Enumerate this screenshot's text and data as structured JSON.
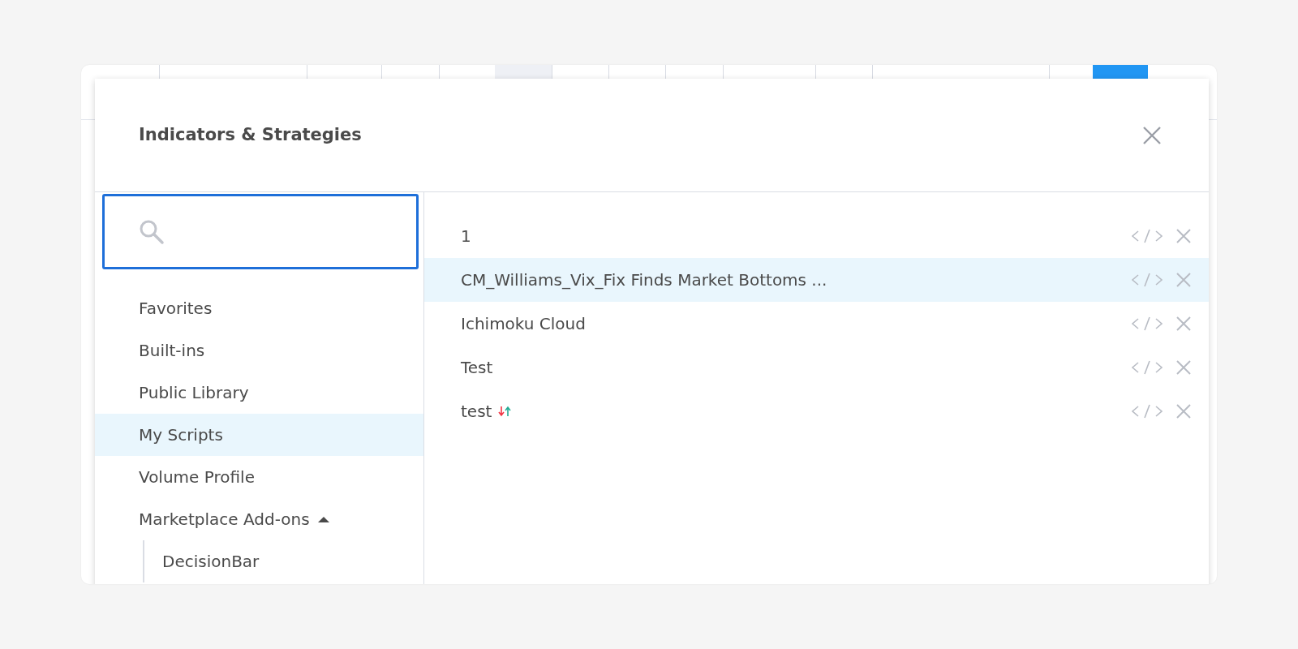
{
  "dialog": {
    "title": "Indicators & Strategies"
  },
  "categories": [
    {
      "label": "Favorites",
      "selected": false
    },
    {
      "label": "Built-ins",
      "selected": false
    },
    {
      "label": "Public Library",
      "selected": false
    },
    {
      "label": "My Scripts",
      "selected": true
    },
    {
      "label": "Volume Profile",
      "selected": false
    },
    {
      "label": "Marketplace Add-ons",
      "selected": false,
      "expanded": true,
      "children": [
        {
          "label": "DecisionBar",
          "selected": false
        }
      ]
    }
  ],
  "scripts": [
    {
      "name": "1",
      "kind": "indicator",
      "selected": false
    },
    {
      "name": "CM_Williams_Vix_Fix Finds Market Bottoms ...",
      "kind": "indicator",
      "selected": true
    },
    {
      "name": "Ichimoku Cloud",
      "kind": "indicator",
      "selected": false
    },
    {
      "name": "Test",
      "kind": "indicator",
      "selected": false
    },
    {
      "name": "test",
      "kind": "strategy",
      "selected": false
    }
  ]
}
